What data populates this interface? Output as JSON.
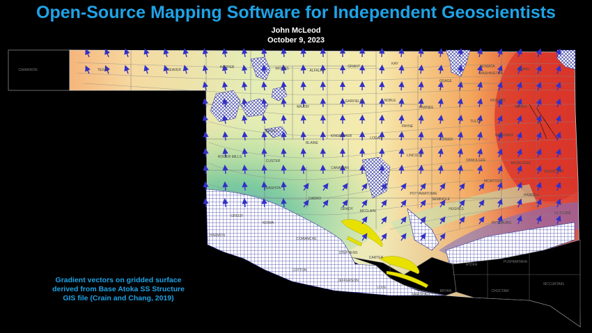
{
  "header": {
    "title": "Open-Source Mapping Software for Independent Geoscientists",
    "author": "John McLeod",
    "date": "October 9, 2023"
  },
  "caption": {
    "line1": "Gradient vectors on gridded surface",
    "line2": "derived from Base Atoka SS Structure",
    "line3": "GIS file (Crain and Chang, 2019)"
  },
  "map": {
    "colors": {
      "high": "#d8342a",
      "mid_high": "#f29a52",
      "mid": "#f3efb4",
      "low": "#8fd18f",
      "deep": "#6aaec7",
      "vector": "#3330c8",
      "hatch": "#2a2f9a",
      "fault": "#e8e100",
      "title_blue": "#1fa3e6"
    },
    "counties": [
      {
        "name": "CIMARRON",
        "dark": true
      },
      {
        "name": "TEXAS"
      },
      {
        "name": "BEAVER"
      },
      {
        "name": "HARPER"
      },
      {
        "name": "WOODS"
      },
      {
        "name": "ALFALFA"
      },
      {
        "name": "GRANT"
      },
      {
        "name": "KAY"
      },
      {
        "name": "OSAGE"
      },
      {
        "name": "NOWATA"
      },
      {
        "name": "WASHINGTON"
      },
      {
        "name": "CRAIG"
      },
      {
        "name": "MAJOR"
      },
      {
        "name": "GARFIELD"
      },
      {
        "name": "NOBLE"
      },
      {
        "name": "PAWNEE"
      },
      {
        "name": "ROGERS"
      },
      {
        "name": "MAYES"
      },
      {
        "name": "DEWEY"
      },
      {
        "name": "BLAINE"
      },
      {
        "name": "KINGFISHER"
      },
      {
        "name": "LOGAN"
      },
      {
        "name": "PAYNE"
      },
      {
        "name": "CREEK"
      },
      {
        "name": "TULSA"
      },
      {
        "name": "WAGONER"
      },
      {
        "name": "ROGER MILLS"
      },
      {
        "name": "CUSTER"
      },
      {
        "name": "CANADIAN"
      },
      {
        "name": "LINCOLN"
      },
      {
        "name": "OKMULGEE"
      },
      {
        "name": "MUSKOGEE"
      },
      {
        "name": "SEQUOYAH"
      },
      {
        "name": "WASHITA"
      },
      {
        "name": "CADDO"
      },
      {
        "name": "GRADY"
      },
      {
        "name": "MCCLAIN"
      },
      {
        "name": "POTTAWATOMIE"
      },
      {
        "name": "SEMINOLE"
      },
      {
        "name": "MCINTOSH"
      },
      {
        "name": "HASKELL"
      },
      {
        "name": "HUGHES"
      },
      {
        "name": "PITTSBURG"
      },
      {
        "name": "LE FLORE"
      },
      {
        "name": "GREER"
      },
      {
        "name": "HARMON"
      },
      {
        "name": "KIOWA"
      },
      {
        "name": "COMANCHE"
      },
      {
        "name": "COTTON"
      },
      {
        "name": "STEPHENS"
      },
      {
        "name": "JEFFERSON"
      },
      {
        "name": "CARTER"
      },
      {
        "name": "LOVE"
      },
      {
        "name": "MARSHALL"
      },
      {
        "name": "ATOKA",
        "dark": true
      },
      {
        "name": "PUSHMATAHA",
        "dark": true
      },
      {
        "name": "MCCURTAIN",
        "dark": true
      },
      {
        "name": "CHOCTAW",
        "dark": true
      },
      {
        "name": "BRYAN",
        "dark": true
      }
    ]
  }
}
